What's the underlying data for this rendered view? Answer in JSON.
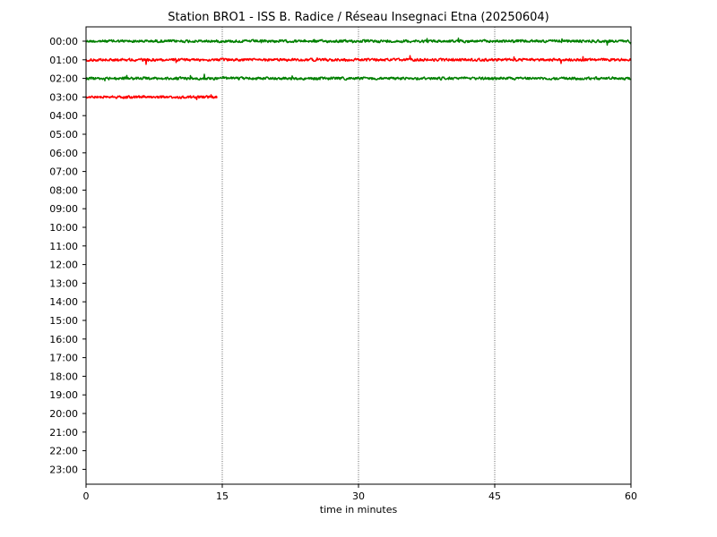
{
  "chart_data": {
    "type": "line",
    "title": "Station BRO1 -  ISS B. Radice / Réseau Insegnaci Etna (20250604)",
    "xlabel": "time in minutes",
    "ylabel": "",
    "xlim": [
      0,
      60
    ],
    "xticks": [
      0,
      15,
      30,
      45,
      60
    ],
    "xtick_labels": [
      "0",
      "15",
      "30",
      "45",
      "60"
    ],
    "grid": "vertical dotted lines at 15, 30, 45 minutes",
    "yticks": [
      "00:00",
      "01:00",
      "02:00",
      "03:00",
      "04:00",
      "05:00",
      "06:00",
      "07:00",
      "08:00",
      "09:00",
      "10:00",
      "11:00",
      "12:00",
      "13:00",
      "14:00",
      "15:00",
      "16:00",
      "17:00",
      "18:00",
      "19:00",
      "20:00",
      "21:00",
      "22:00",
      "23:00"
    ],
    "series": [
      {
        "row": "00:00",
        "color": "#008000",
        "x_end": 60
      },
      {
        "row": "01:00",
        "color": "#ff0000",
        "x_end": 60
      },
      {
        "row": "02:00",
        "color": "#008000",
        "x_end": 60
      },
      {
        "row": "03:00",
        "color": "#ff0000",
        "x_end": 14.5
      }
    ]
  }
}
